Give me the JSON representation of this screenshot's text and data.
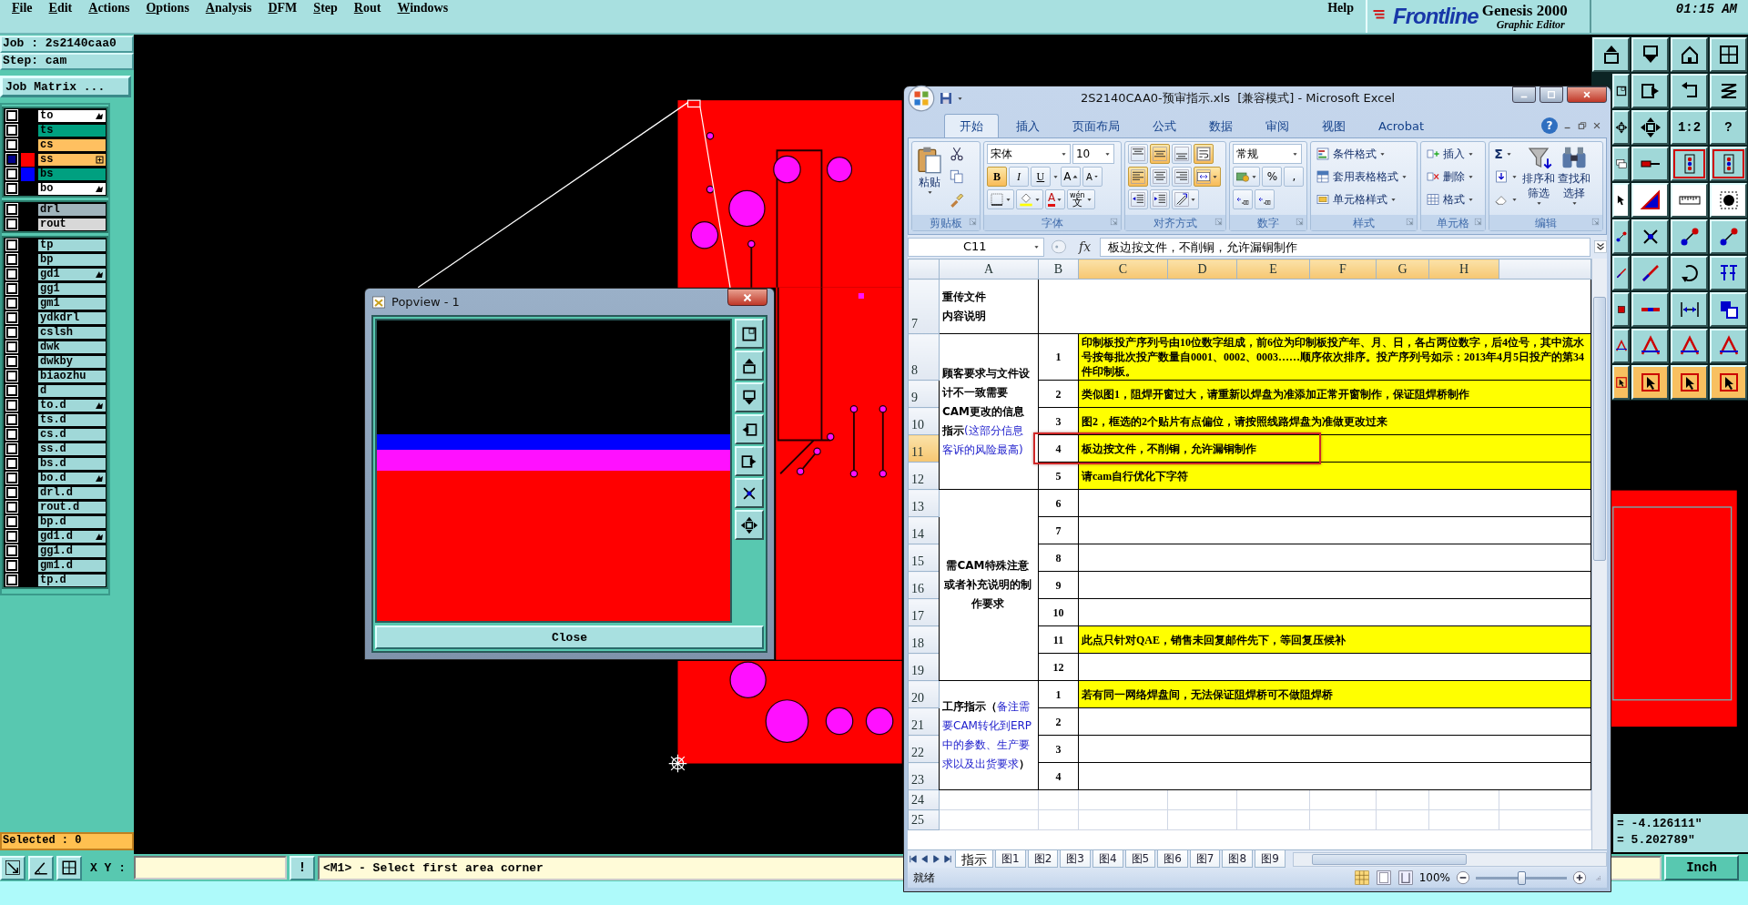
{
  "menu_bar": {
    "items": [
      "File",
      "Edit",
      "Actions",
      "Options",
      "Analysis",
      "DFM",
      "Step",
      "Rout",
      "Windows"
    ],
    "help": "Help"
  },
  "brand": {
    "logo": "Frontline",
    "product": "Genesis 2000",
    "subtitle": "Graphic Editor",
    "time": "01:15 AM"
  },
  "job_panel": {
    "job": "Job : 2s2140caa0",
    "step": "Step: cam",
    "matrix_button": "Job Matrix ...",
    "selected_count": "Selected : 0",
    "layer_groups": [
      {
        "layers": [
          {
            "name": "to",
            "color": "#ffffff",
            "arrow": true,
            "boxed": false,
            "selected": false
          },
          {
            "name": "ts",
            "color": "#00a080",
            "arrow": false,
            "boxed": false,
            "selected": false
          },
          {
            "name": "cs",
            "color": "#ffc060",
            "arrow": false,
            "boxed": false,
            "selected": false
          },
          {
            "name": "ss",
            "color": "#ffc060",
            "arrow": false,
            "boxed": true,
            "swatch": {
              "color": "#ff0000"
            },
            "selected": true
          },
          {
            "name": "bs",
            "color": "#00a080",
            "arrow": false,
            "boxed": false,
            "swatch": {
              "color": "#0000ff"
            },
            "selected": false
          },
          {
            "name": "bo",
            "color": "#ffffff",
            "arrow": true,
            "boxed": false,
            "selected": false
          }
        ]
      },
      {
        "layers": [
          {
            "name": "drl",
            "color": "#a0b4bc",
            "arrow": false,
            "boxed": false,
            "selected": false
          },
          {
            "name": "rout",
            "color": "#d8d8d8",
            "arrow": false,
            "boxed": false,
            "selected": false
          }
        ]
      },
      {
        "layers": [
          {
            "name": "tp",
            "color": "#a0d8d8",
            "arrow": false,
            "boxed": false,
            "selected": false
          },
          {
            "name": "bp",
            "color": "#a0d8d8",
            "arrow": false,
            "boxed": false,
            "selected": false
          },
          {
            "name": "gd1",
            "color": "#a0d8d8",
            "arrow": true,
            "boxed": false,
            "selected": false
          },
          {
            "name": "gg1",
            "color": "#a0d8d8",
            "arrow": false,
            "boxed": false,
            "selected": false
          },
          {
            "name": "gm1",
            "color": "#a0d8d8",
            "arrow": false,
            "boxed": false,
            "selected": false
          },
          {
            "name": "ydkdrl",
            "color": "#a0d8d8",
            "arrow": false,
            "boxed": false,
            "selected": false
          },
          {
            "name": "cslsh",
            "color": "#a0d8d8",
            "arrow": false,
            "boxed": false,
            "selected": false
          },
          {
            "name": "dwk",
            "color": "#a0d8d8",
            "arrow": false,
            "boxed": false,
            "selected": false
          },
          {
            "name": "dwkby",
            "color": "#a0d8d8",
            "arrow": false,
            "boxed": false,
            "selected": false
          },
          {
            "name": "biaozhu",
            "color": "#a0d8d8",
            "arrow": false,
            "boxed": false,
            "selected": false
          },
          {
            "name": "d",
            "color": "#a0d8d8",
            "arrow": false,
            "boxed": false,
            "selected": false
          },
          {
            "name": "to.d",
            "color": "#a0d8d8",
            "arrow": true,
            "boxed": false,
            "selected": false
          },
          {
            "name": "ts.d",
            "color": "#a0d8d8",
            "arrow": false,
            "boxed": false,
            "selected": false
          },
          {
            "name": "cs.d",
            "color": "#a0d8d8",
            "arrow": false,
            "boxed": false,
            "selected": false
          },
          {
            "name": "ss.d",
            "color": "#a0d8d8",
            "arrow": false,
            "boxed": false,
            "selected": false
          },
          {
            "name": "bs.d",
            "color": "#a0d8d8",
            "arrow": false,
            "boxed": false,
            "selected": false
          },
          {
            "name": "bo.d",
            "color": "#a0d8d8",
            "arrow": true,
            "boxed": false,
            "selected": false
          },
          {
            "name": "drl.d",
            "color": "#a0d8d8",
            "arrow": false,
            "boxed": false,
            "selected": false
          },
          {
            "name": "rout.d",
            "color": "#a0d8d8",
            "arrow": false,
            "boxed": false,
            "selected": false
          },
          {
            "name": "bp.d",
            "color": "#a0d8d8",
            "arrow": false,
            "boxed": false,
            "selected": false
          },
          {
            "name": "gd1.d",
            "color": "#a0d8d8",
            "arrow": true,
            "boxed": false,
            "selected": false
          },
          {
            "name": "gg1.d",
            "color": "#a0d8d8",
            "arrow": false,
            "boxed": false,
            "selected": false
          },
          {
            "name": "gm1.d",
            "color": "#a0d8d8",
            "arrow": false,
            "boxed": false,
            "selected": false
          },
          {
            "name": "tp.d",
            "color": "#a0d8d8",
            "arrow": false,
            "boxed": false,
            "selected": false
          }
        ]
      }
    ]
  },
  "tool_palette": {
    "scale_label": "1:2",
    "help_label": "?"
  },
  "readout": {
    "x": "= -4.126111\"",
    "y": "= 5.202789\""
  },
  "bottom_bar": {
    "xy_label": "X Y :",
    "alert": "!",
    "prompt": "<M1> - Select first area corner",
    "units": "Inch"
  },
  "popview": {
    "title": "Popview - 1",
    "close_label": "Close"
  },
  "excel": {
    "title": "2S2140CAA0-预审指示.xls  [兼容模式] - Microsoft Excel",
    "help": "?",
    "tabs": [
      {
        "label": "开始",
        "selected": true
      },
      {
        "label": "插入",
        "selected": false
      },
      {
        "label": "页面布局",
        "selected": false
      },
      {
        "label": "公式",
        "selected": false
      },
      {
        "label": "数据",
        "selected": false
      },
      {
        "label": "审阅",
        "selected": false
      },
      {
        "label": "视图",
        "selected": false
      },
      {
        "label": "Acrobat",
        "selected": false
      }
    ],
    "clipboard": {
      "paste": "粘贴",
      "label": "剪贴板"
    },
    "font": {
      "name": "宋体",
      "size": "10",
      "grow": "A",
      "shrink": "A",
      "color_letter": "A",
      "phonetic": {
        "pinyin": "wén",
        "char": "文"
      },
      "label": "字体",
      "styles": [
        {
          "label": "B",
          "selected": true
        },
        {
          "label": "I",
          "selected": false
        },
        {
          "label": "U",
          "selected": false
        }
      ]
    },
    "alignment": {
      "label": "对齐方式",
      "buttons": [
        {
          "kind": "top",
          "selected": false
        },
        {
          "kind": "middle",
          "selected": true
        },
        {
          "kind": "bottom",
          "selected": false
        },
        {
          "kind": "wrap",
          "selected": true
        },
        {
          "kind": "left",
          "selected": true
        },
        {
          "kind": "center",
          "selected": false
        },
        {
          "kind": "right",
          "selected": false
        },
        {
          "kind": "merge",
          "selected": true
        },
        {
          "kind": "outdent",
          "selected": false
        },
        {
          "kind": "indent",
          "selected": false
        },
        {
          "kind": "orientation",
          "selected": false
        }
      ]
    },
    "number": {
      "format": "常规",
      "percent": "%",
      "comma": ",",
      "label": "数字"
    },
    "styles": {
      "items": [
        "条件格式",
        "套用表格格式",
        "单元格样式"
      ],
      "label": "样式"
    },
    "cells": {
      "items": [
        "插入",
        "删除",
        "格式"
      ],
      "label": "单元格"
    },
    "editing": {
      "sum": "Σ",
      "sort": [
        "排序和",
        "筛选"
      ],
      "find": [
        "查找和",
        "选择"
      ],
      "label": "编辑"
    },
    "formula_bar": {
      "name_box": "C11",
      "fx": "fx",
      "content": "板边按文件，不削铜，允许漏铜制作"
    },
    "columns": [
      {
        "label": "A",
        "selected": false
      },
      {
        "label": "B",
        "selected": false
      },
      {
        "label": "C",
        "selected": true
      },
      {
        "label": "D",
        "selected": true
      },
      {
        "label": "E",
        "selected": true
      },
      {
        "label": "F",
        "selected": true
      },
      {
        "label": "G",
        "selected": true
      },
      {
        "label": "H",
        "selected": true
      }
    ],
    "sections": [
      {
        "centered": false,
        "stacked": true,
        "heading": [
          {
            "text": "重传文件",
            "note": false
          },
          {
            "text": "内容说明",
            "note": false
          }
        ],
        "rows": [
          {
            "row": "7",
            "highlighted": false,
            "selected": false
          }
        ]
      },
      {
        "centered": false,
        "stacked": false,
        "heading": [
          {
            "text": "顾客要求与文件设计不一致需要CAM更改的信息指示",
            "note": false
          },
          {
            "text": "(这部分信息客诉的风险最高)",
            "note": true
          }
        ],
        "rows": [
          {
            "row": "8",
            "number": "1",
            "text": "印制板投产序列号由10位数字组成，前6位为印制板投产年、月、日，各占两位数字，后4位号，其中流水号按每批次投产数量自0001、0002、0003……顺序依次排序。投产序列号如示：2013年4月5日投产的第34件印制板。",
            "highlighted": true,
            "selected": false
          },
          {
            "row": "9",
            "number": "2",
            "text": "类似图1，阻焊开窗过大，请重新以焊盘为准添加正常开窗制作，保证阻焊桥制作",
            "highlighted": true,
            "selected": false
          },
          {
            "row": "10",
            "number": "3",
            "text": "图2，框选的2个贴片有点偏位，请按照线路焊盘为准做更改过来",
            "highlighted": true,
            "selected": false
          },
          {
            "row": "11",
            "number": "4",
            "text": "板边按文件，不削铜，允许漏铜制作",
            "highlighted": true,
            "selected": true
          },
          {
            "row": "12",
            "number": "5",
            "text": "请cam自行优化下字符",
            "highlighted": true,
            "selected": false
          }
        ]
      },
      {
        "centered": true,
        "stacked": false,
        "heading": [
          {
            "text": "需CAM特殊注意或者补充说明的制作要求",
            "note": false
          }
        ],
        "rows": [
          {
            "row": "13",
            "number": "6",
            "highlighted": false,
            "selected": false
          },
          {
            "row": "14",
            "number": "7",
            "highlighted": false,
            "selected": false
          },
          {
            "row": "15",
            "number": "8",
            "highlighted": false,
            "selected": false
          },
          {
            "row": "16",
            "number": "9",
            "highlighted": false,
            "selected": false
          },
          {
            "row": "17",
            "number": "10",
            "highlighted": false,
            "selected": false
          },
          {
            "row": "18",
            "number": "11",
            "text": "此点只针对QAE，销售未回复邮件先下，等回复压候补",
            "highlighted": true,
            "selected": false
          },
          {
            "row": "19",
            "number": "12",
            "highlighted": false,
            "selected": false
          }
        ]
      },
      {
        "centered": false,
        "stacked": false,
        "heading": [
          {
            "text": "工序指示（",
            "note": false
          },
          {
            "text": "备注需要CAM转化到ERP中的参数、生产要求以及出货要求",
            "note": true
          },
          {
            "text": "）",
            "note": false
          }
        ],
        "rows": [
          {
            "row": "20",
            "number": "1",
            "text": "若有同一网络焊盘间，无法保证阻焊桥可不做阻焊桥",
            "highlighted": true,
            "selected": false
          },
          {
            "row": "21",
            "number": "2",
            "highlighted": false,
            "selected": false
          },
          {
            "row": "22",
            "number": "3",
            "highlighted": false,
            "selected": false
          },
          {
            "row": "23",
            "number": "4",
            "highlighted": false,
            "selected": false
          }
        ]
      }
    ],
    "empty_rows": [
      "24",
      "25"
    ],
    "sheet_tabs": [
      {
        "label": "指示",
        "selected": true
      },
      {
        "label": "图1",
        "selected": false
      },
      {
        "label": "图2",
        "selected": false
      },
      {
        "label": "图3",
        "selected": false
      },
      {
        "label": "图4",
        "selected": false
      },
      {
        "label": "图5",
        "selected": false
      },
      {
        "label": "图6",
        "selected": false
      },
      {
        "label": "图7",
        "selected": false
      },
      {
        "label": "图8",
        "selected": false
      },
      {
        "label": "图9",
        "selected": false
      }
    ],
    "status": "就绪",
    "zoom": {
      "label": "100%",
      "level": 0.5
    }
  }
}
